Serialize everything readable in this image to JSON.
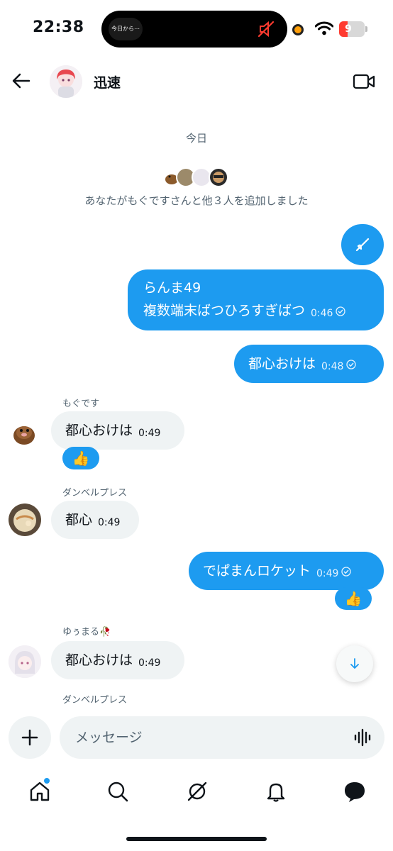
{
  "status_bar": {
    "time": "22:38",
    "island_text": "今日から⋯",
    "battery": "9",
    "icons": [
      "mute-icon",
      "wifi-icon",
      "battery-icon"
    ]
  },
  "header": {
    "title": "迅速",
    "back_icon": "arrow-left-icon",
    "video_icon": "video-call-icon"
  },
  "conversation": {
    "date_label": "今日",
    "system_message": "あなたがもぐですさんと他３人を追加しました",
    "messages": [
      {
        "direction": "out",
        "type": "icon",
        "icon": "pen-icon"
      },
      {
        "direction": "out",
        "lines": [
          "らんま49",
          "複数端末ばつひろすぎばつ"
        ],
        "time": "0:46"
      },
      {
        "direction": "out",
        "text": "都心おけは",
        "time": "0:48"
      },
      {
        "direction": "in",
        "sender": "もぐです",
        "text": "都心おけは",
        "time": "0:49",
        "reaction": "👍"
      },
      {
        "direction": "in",
        "sender": "ダンベルプレス",
        "text": "都心",
        "time": "0:49"
      },
      {
        "direction": "out",
        "text": "でぱまんロケット",
        "time": "0:49",
        "reaction": "👍"
      },
      {
        "direction": "in",
        "sender": "ゆぅまる🥀",
        "text": "都心おけは",
        "time": "0:49"
      },
      {
        "direction": "in",
        "sender": "ダンベルプレス"
      }
    ]
  },
  "composer": {
    "placeholder": "メッセージ",
    "add_icon": "plus-icon",
    "voice_icon": "voice-waveform-icon"
  },
  "tabbar": {
    "items": [
      "home-icon",
      "search-icon",
      "grok-icon",
      "notifications-icon",
      "messages-icon"
    ]
  },
  "colors": {
    "accent": "#1d9bf0",
    "incoming_bubble": "#eff3f4",
    "secondary_text": "#536471"
  }
}
